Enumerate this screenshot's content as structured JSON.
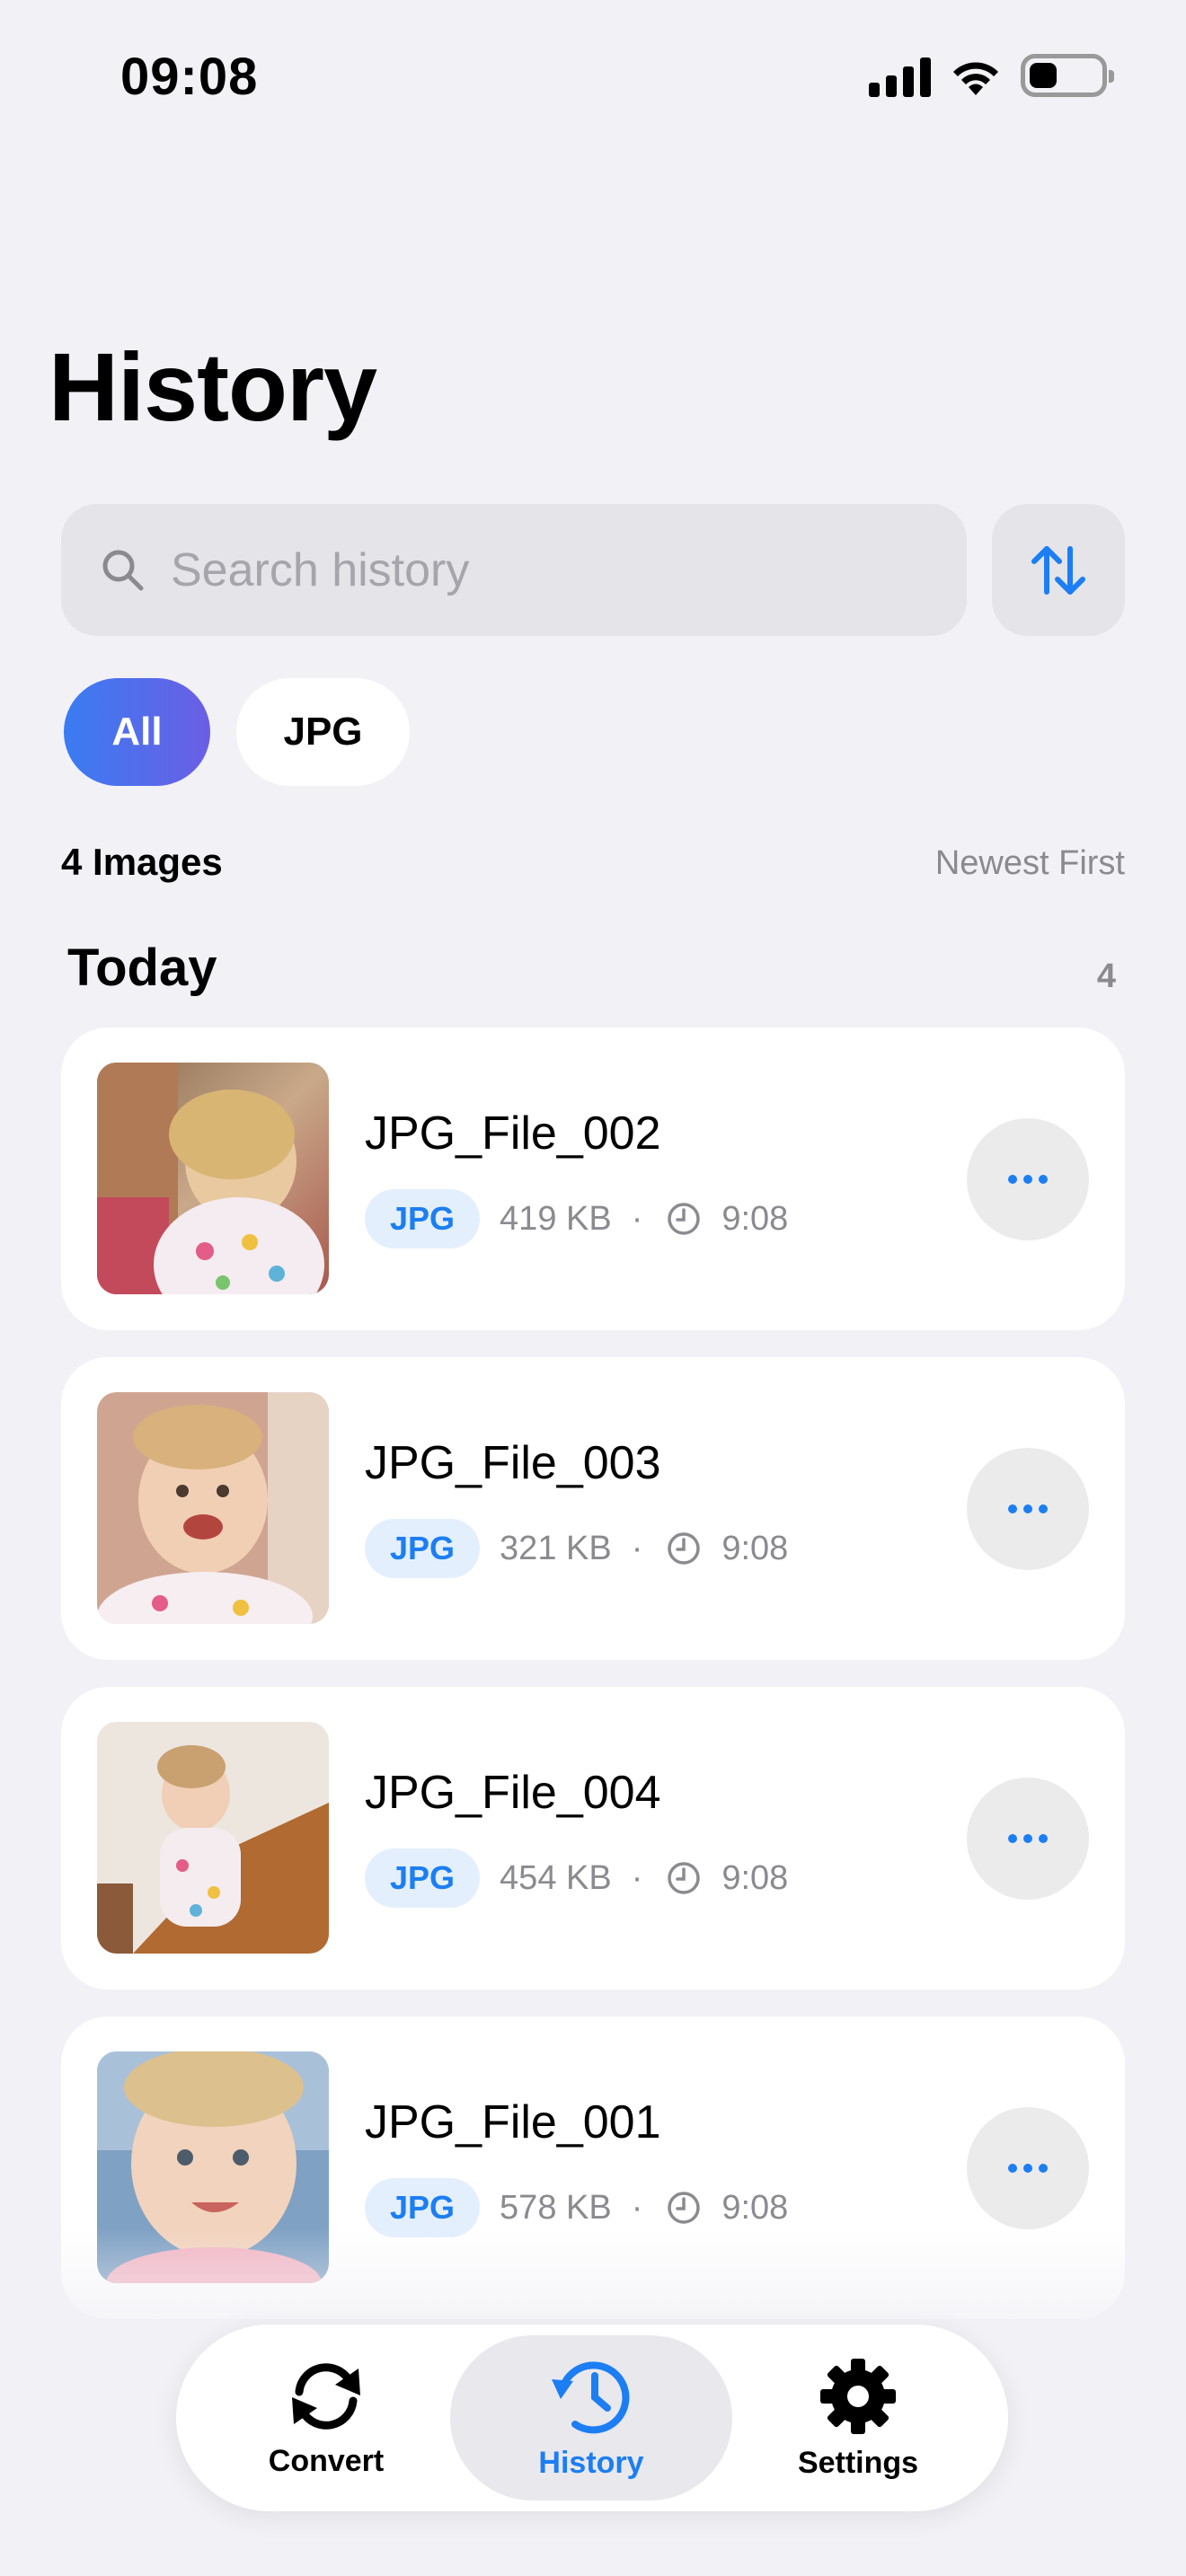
{
  "status_bar": {
    "time": "09:08"
  },
  "header": {
    "title": "History"
  },
  "search": {
    "placeholder": "Search history",
    "value": ""
  },
  "filters": {
    "all_label": "All",
    "jpg_label": "JPG",
    "selected": "All"
  },
  "summary": {
    "count_label": "4 Images",
    "sort_label": "Newest First"
  },
  "section": {
    "title": "Today",
    "count": "4"
  },
  "items": [
    {
      "name": "JPG_File_002",
      "format": "JPG",
      "size": "419 KB",
      "time": "9:08"
    },
    {
      "name": "JPG_File_003",
      "format": "JPG",
      "size": "321 KB",
      "time": "9:08"
    },
    {
      "name": "JPG_File_004",
      "format": "JPG",
      "size": "454 KB",
      "time": "9:08"
    },
    {
      "name": "JPG_File_001",
      "format": "JPG",
      "size": "578 KB",
      "time": "9:08"
    }
  ],
  "tab_bar": {
    "convert_label": "Convert",
    "history_label": "History",
    "settings_label": "Settings",
    "active": "History"
  },
  "colors": {
    "accent": "#1c7ef2",
    "chip_gradient_start": "#3a7cf2",
    "chip_gradient_end": "#6b5ee4",
    "background": "#f1f1f6"
  },
  "icons": {
    "search": "search-icon",
    "sort": "sort-arrows-icon",
    "clock": "clock-icon",
    "more": "more-dots-icon",
    "convert": "refresh-icon",
    "history": "history-clock-icon",
    "settings": "gear-icon"
  }
}
